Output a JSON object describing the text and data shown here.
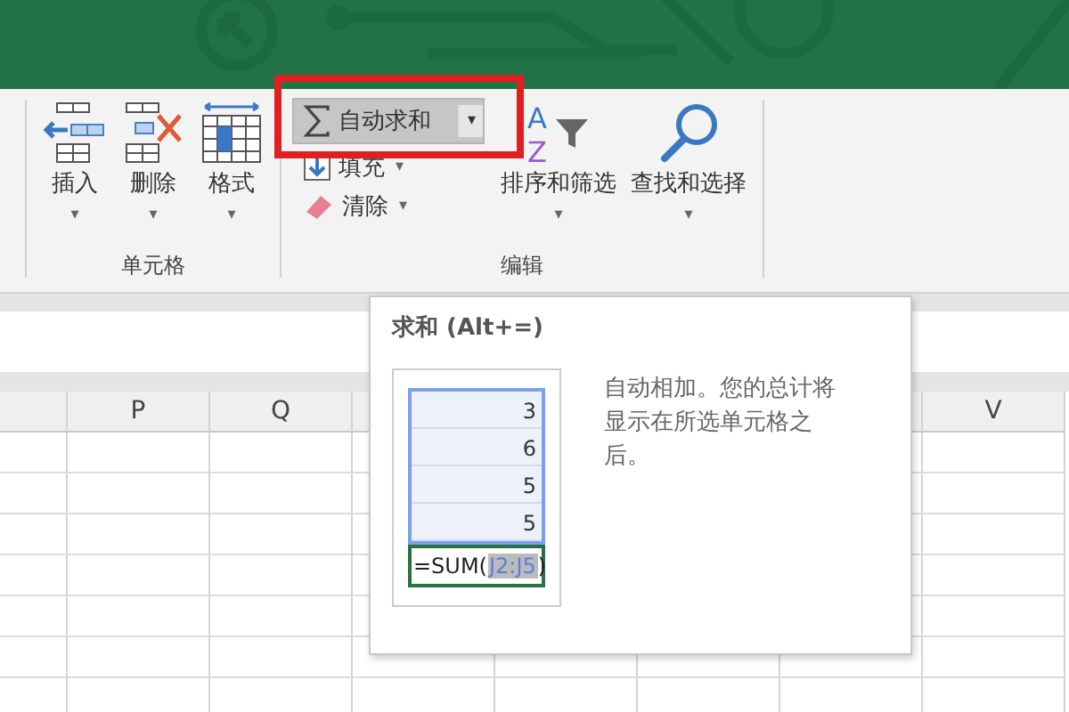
{
  "ribbon": {
    "groups": [
      {
        "label": "单元格",
        "buttons": [
          {
            "kind": "large",
            "label": "插入",
            "caret": "▾"
          },
          {
            "kind": "large",
            "label": "删除",
            "caret": "▾"
          },
          {
            "kind": "large",
            "label": "格式",
            "caret": "▾"
          }
        ]
      },
      {
        "label": "编辑",
        "buttons": [
          {
            "kind": "split",
            "label": "自动求和",
            "caret": "▾",
            "highlighted": true,
            "pressed": true
          },
          {
            "kind": "small",
            "label": "填充",
            "caret": "▾"
          },
          {
            "kind": "small",
            "label": "清除",
            "caret": "▾"
          },
          {
            "kind": "large",
            "label": "排序和筛选",
            "caret": "▾",
            "icon_letters": [
              "A",
              "Z"
            ]
          },
          {
            "kind": "large",
            "label": "查找和选择",
            "caret": "▾"
          }
        ]
      }
    ]
  },
  "sheet": {
    "columns": [
      "P",
      "Q",
      "V"
    ]
  },
  "tooltip": {
    "title": "求和 (Alt+=)",
    "description": "自动相加。您的总计将显示在所选单元格之后。",
    "example": {
      "values": [
        "3",
        "6",
        "5",
        "5"
      ],
      "formula_start": "=SUM(",
      "formula_range": "J2:J5",
      "formula_end": ")"
    }
  }
}
